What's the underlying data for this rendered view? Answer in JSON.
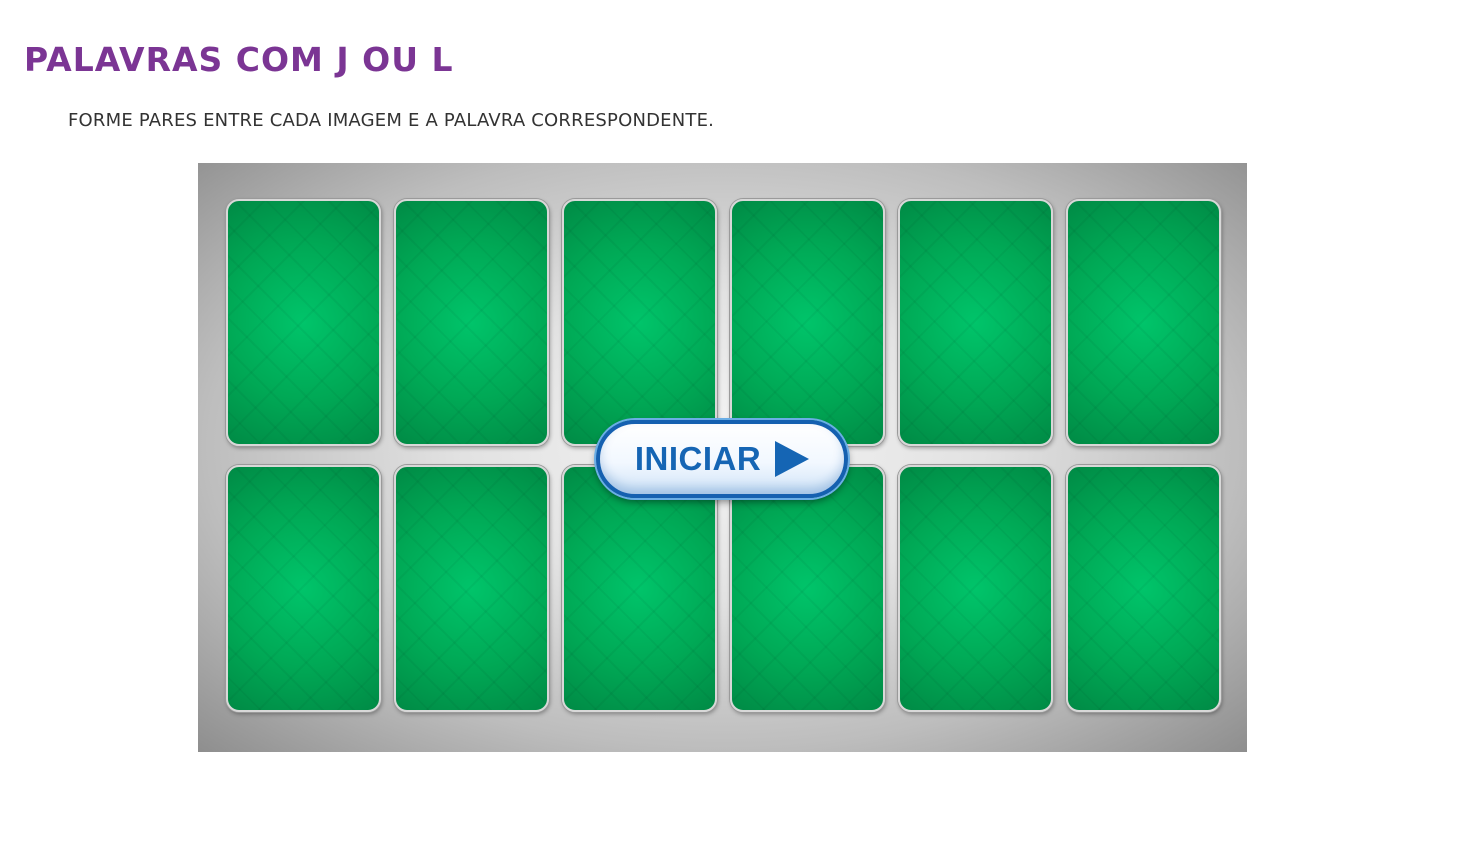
{
  "header": {
    "title": "PALAVRAS COM J OU L",
    "instructions": "FORME PARES ENTRE CADA IMAGEM E A PALAVRA CORRESPONDENTE."
  },
  "game": {
    "start_label": "INICIAR",
    "start_icon": "play-icon",
    "cards_face_down": 12,
    "colors": {
      "title": "#7b3594",
      "card_back": "#00a855",
      "button_accent": "#1565b4"
    }
  }
}
